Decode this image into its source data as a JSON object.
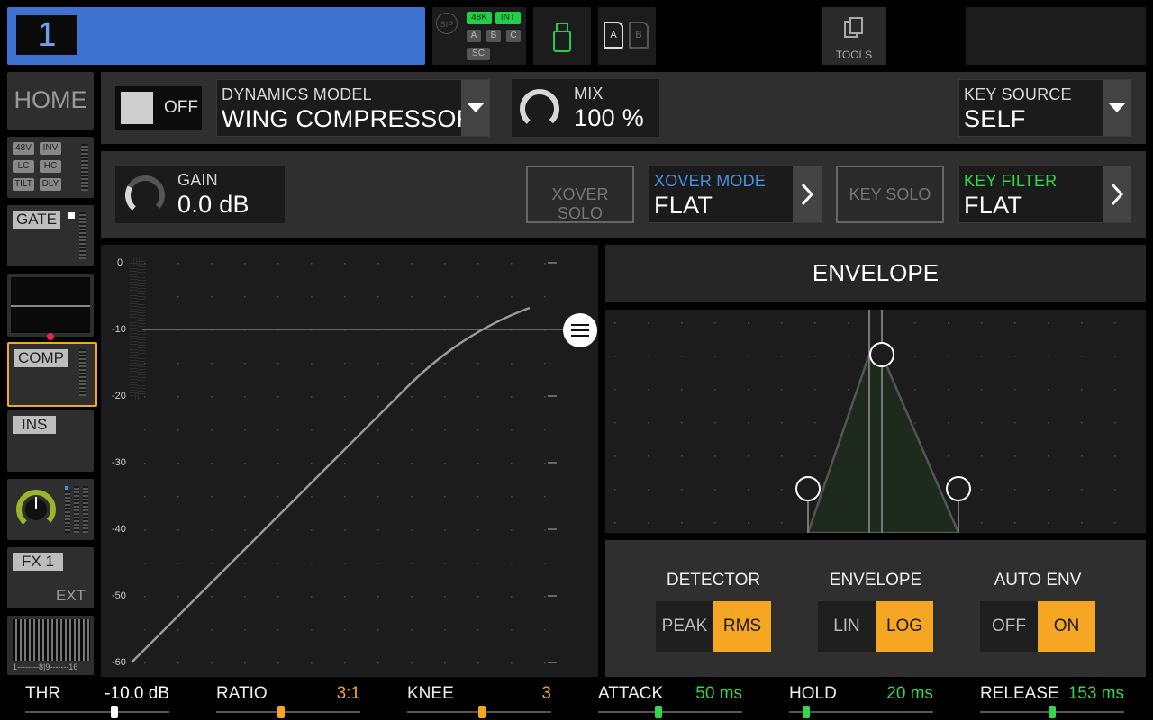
{
  "top": {
    "channel_number": "1",
    "sip_label": "SIP",
    "rate_badge": "48K",
    "int_badge": "INT",
    "slots": [
      "A",
      "B",
      "C"
    ],
    "sc_badge": "SC",
    "card_a": "A",
    "card_b": "B",
    "tools_label": "TOOLS"
  },
  "sidebar": {
    "home_label": "HOME",
    "tags": [
      "48V",
      "INV",
      "LC",
      "HC",
      "TILT",
      "DLY"
    ],
    "gate_label": "GATE",
    "comp_label": "COMP",
    "ins_label": "INS",
    "fx_label": "FX 1",
    "ext_label": "EXT",
    "meter_scale": "1--------8|9-------16"
  },
  "row1": {
    "toggle_state": "OFF",
    "model_title": "DYNAMICS MODEL",
    "model_value": "WING COMPRESSOR",
    "mix_title": "MIX",
    "mix_value": "100 %",
    "key_source_title": "KEY SOURCE",
    "key_source_value": "SELF"
  },
  "row2": {
    "gain_title": "GAIN",
    "gain_value": "0.0 dB",
    "xover_solo": "XOVER SOLO",
    "xover_mode_title": "XOVER MODE",
    "xover_mode_value": "FLAT",
    "key_solo": "KEY SOLO",
    "key_filter_title": "KEY FILTER",
    "key_filter_value": "FLAT"
  },
  "graph": {
    "y_labels": [
      "0",
      "-10",
      "-20",
      "-30",
      "-40",
      "-50",
      "-60"
    ]
  },
  "envelope": {
    "title": "ENVELOPE",
    "detector_title": "DETECTOR",
    "detector_options": [
      "PEAK",
      "RMS"
    ],
    "detector_selected": "RMS",
    "env_title": "ENVELOPE",
    "env_options": [
      "LIN",
      "LOG"
    ],
    "env_selected": "LOG",
    "auto_title": "AUTO ENV",
    "auto_options": [
      "OFF",
      "ON"
    ],
    "auto_selected": "ON"
  },
  "params": [
    {
      "name": "THR",
      "value": "-10.0 dB",
      "color": "#ffffff",
      "level": 0.62
    },
    {
      "name": "RATIO",
      "value": "3:1",
      "color": "#f5a623",
      "level": 0.45
    },
    {
      "name": "KNEE",
      "value": "3",
      "color": "#f5a623",
      "level": 0.52
    },
    {
      "name": "ATTACK",
      "value": "50 ms",
      "color": "#2fd84f",
      "level": 0.42
    },
    {
      "name": "HOLD",
      "value": "20 ms",
      "color": "#2fd84f",
      "level": 0.12
    },
    {
      "name": "RELEASE",
      "value": "153 ms",
      "color": "#2fd84f",
      "level": 0.5
    }
  ],
  "colors": {
    "accent_orange": "#f5a623",
    "accent_green": "#2fd84f",
    "accent_blue": "#4a7fd6",
    "channel_bar": "#3d72d1"
  }
}
